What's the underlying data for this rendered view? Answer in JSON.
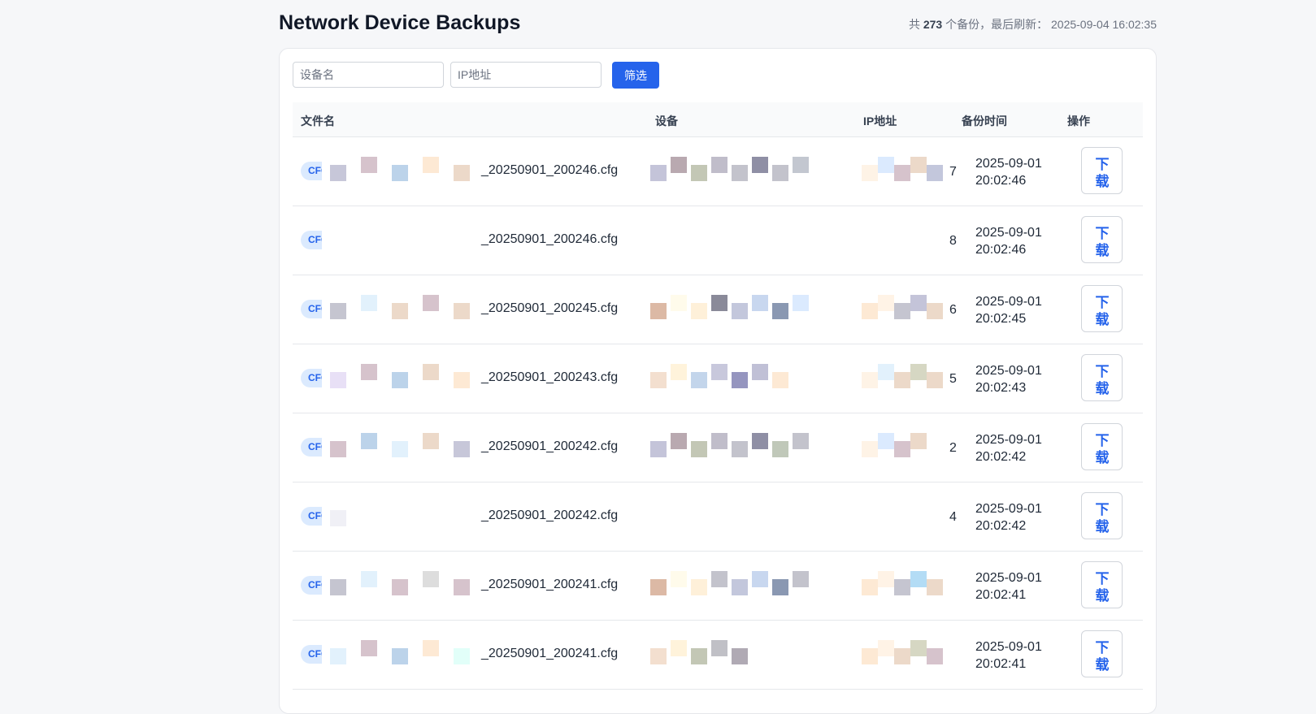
{
  "header": {
    "title": "Network Device Backups",
    "summary_prefix": "共",
    "summary_count": "273",
    "summary_mid": "个备份，最后刷新：",
    "summary_time": "2025-09-04 16:02:35"
  },
  "filters": {
    "device_placeholder": "设备名",
    "ip_placeholder": "IP地址",
    "button_label": "筛选"
  },
  "table": {
    "columns": [
      "文件名",
      "设备",
      "IP地址",
      "备份时间",
      "操作"
    ],
    "rows": [
      {
        "badge": "CFG",
        "filename_suffix": "_20250901_200246.cfg",
        "ip_tail": "7",
        "date": "2025-09-01",
        "time": "20:02:46",
        "action": "下载"
      },
      {
        "badge": "CFG",
        "filename_suffix": "_20250901_200246.cfg",
        "ip_tail": "8",
        "date": "2025-09-01",
        "time": "20:02:46",
        "action": "下载"
      },
      {
        "badge": "CFG",
        "filename_suffix": "_20250901_200245.cfg",
        "ip_tail": "6",
        "date": "2025-09-01",
        "time": "20:02:45",
        "action": "下载"
      },
      {
        "badge": "CFG",
        "filename_suffix": "_20250901_200243.cfg",
        "ip_tail": "5",
        "date": "2025-09-01",
        "time": "20:02:43",
        "action": "下载"
      },
      {
        "badge": "CFG",
        "filename_suffix": "_20250901_200242.cfg",
        "ip_tail": "2",
        "date": "2025-09-01",
        "time": "20:02:42",
        "action": "下载"
      },
      {
        "badge": "CFG",
        "filename_suffix": "_20250901_200242.cfg",
        "ip_tail": "4",
        "date": "2025-09-01",
        "time": "20:02:42",
        "action": "下载"
      },
      {
        "badge": "CFG",
        "filename_suffix": "_20250901_200241.cfg",
        "ip_tail": "",
        "date": "2025-09-01",
        "time": "20:02:41",
        "action": "下载"
      },
      {
        "badge": "CFG",
        "filename_suffix": "_20250901_200241.cfg",
        "ip_tail": "",
        "date": "2025-09-01",
        "time": "20:02:41",
        "action": "下载"
      }
    ]
  },
  "colors": {
    "accent": "#2563eb",
    "badge_bg": "#dbeafe",
    "page_bg": "#f6f7f9"
  }
}
